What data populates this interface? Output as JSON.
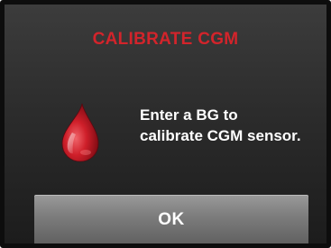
{
  "dialog": {
    "title": "CALIBRATE CGM",
    "message": "Enter a BG to\ncalibrate CGM sensor.",
    "icon": "blood-drop-icon",
    "ok_label": "OK"
  },
  "colors": {
    "title": "#d3242b",
    "background": "#2c2c2c",
    "button": "#7e7e7e",
    "text": "#ffffff"
  }
}
